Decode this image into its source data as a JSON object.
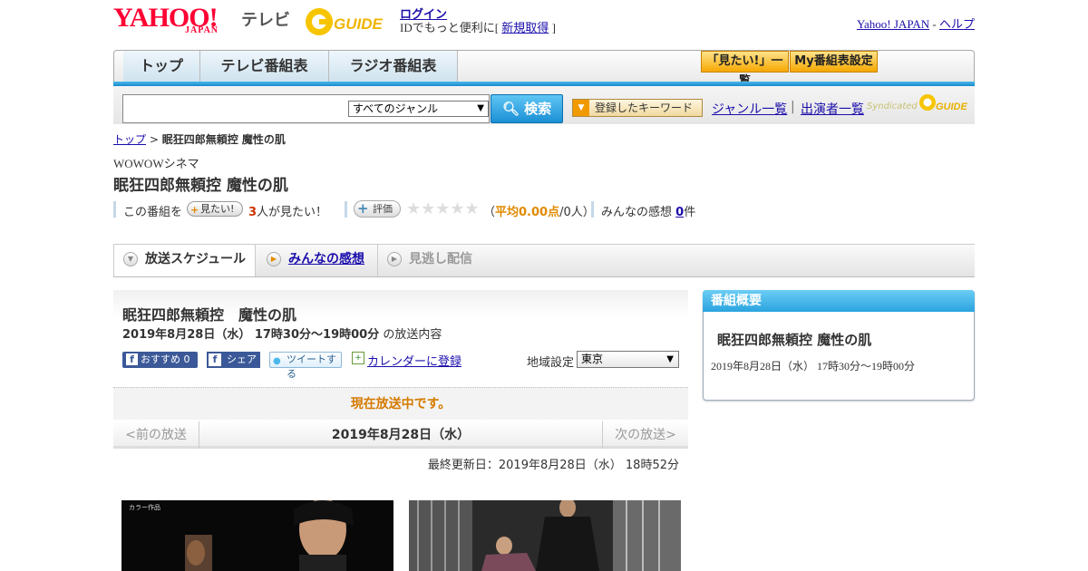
{
  "header": {
    "logo_yahoo": "YAHOO!",
    "logo_japan": "JAPAN",
    "logo_tv": "テレビ",
    "logo_guide": "GUIDE",
    "login": "ログイン",
    "login_sub_prefix": "IDでもっと便利に[",
    "signup": "新規取得",
    "login_sub_suffix": "]",
    "yahoo_japan_link": "Yahoo! JAPAN",
    "dash": "-",
    "help_link": "ヘルプ"
  },
  "nav": {
    "tabs": [
      "トップ",
      "テレビ番組表",
      "ラジオ番組表"
    ],
    "want_list": "「見たい!」一覧",
    "my_schedule": "My番組表設定"
  },
  "search": {
    "genre_selected": "すべてのジャンル",
    "button": "検索",
    "keyword_button": "登録したキーワード",
    "genre_list": "ジャンル一覧",
    "sep": "|",
    "cast_list": "出演者一覧",
    "syndicated": "Syndicated",
    "syn_guide": "GUIDE"
  },
  "breadcrumb": {
    "top": "トップ",
    "sep": " > ",
    "current": "眠狂四郎無頼控 魔性の肌"
  },
  "program": {
    "channel": "WOWOWシネマ",
    "title": "眠狂四郎無頼控 魔性の肌",
    "want_prefix": "この番組を",
    "want_button": "見たい!",
    "want_count": "3",
    "want_suffix": "人が見たい！",
    "rate_button": "評価",
    "stars": "★★★★★",
    "avg_open": "（",
    "avg_label": "平均0.00点",
    "avg_rest": "/0人）",
    "review_label": "みんなの感想",
    "review_count": "0",
    "review_unit": "件"
  },
  "tabs": {
    "schedule": "放送スケジュール",
    "reviews": "みんなの感想",
    "missed": "見逃し配信"
  },
  "detail": {
    "title": "眠狂四郎無頼控　魔性の肌",
    "date_time": "2019年8月28日（水）  17時30分～19時00分",
    "date_suffix": "の放送内容",
    "fb_recommend": "おすすめ 0",
    "fb_share": "シェア",
    "tweet": "ツイートする",
    "calendar": "カレンダーに登録",
    "region_label": "地域設定",
    "region_selected": "東京",
    "onair": "現在放送中です。",
    "prev": "<前の放送",
    "date_center": "2019年8月28日（水）",
    "next": "次の放送>",
    "updated": "最終更新日：2019年8月28日（水）  18時52分",
    "photo_caption": "カラー作品"
  },
  "sidebar": {
    "head": "番組概要",
    "title": "眠狂四郎無頼控 魔性の肌",
    "time": "2019年8月28日（水）  17時30分～19時00分"
  },
  "colors": {
    "yahoo_red": "#ff0033",
    "accent_blue": "#2aa3df",
    "onair_orange": "#d57a00",
    "link": "#1a0dab"
  }
}
